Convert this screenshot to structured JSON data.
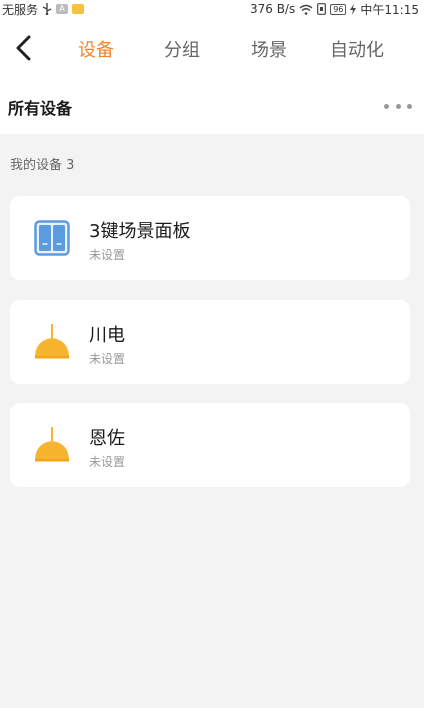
{
  "status_bar": {
    "carrier": "无服务",
    "speed": "376 B/s",
    "battery": "96",
    "time": "中午11:15"
  },
  "header": {
    "tabs": [
      {
        "label": "设备",
        "active": true
      },
      {
        "label": "分组",
        "active": false
      },
      {
        "label": "场景",
        "active": false
      },
      {
        "label": "自动化",
        "active": false
      }
    ]
  },
  "section": {
    "title": "所有设备"
  },
  "group": {
    "label": "我的设备 3"
  },
  "devices": [
    {
      "name": "3键场景面板",
      "status": "未设置",
      "icon": "scene-panel-icon"
    },
    {
      "name": "川电",
      "status": "未设置",
      "icon": "lamp-icon"
    },
    {
      "name": "恩佐",
      "status": "未设置",
      "icon": "lamp-icon"
    }
  ],
  "colors": {
    "accent": "#f0862d",
    "lamp": "#f7b52f",
    "panel": "#5b9be0",
    "background": "#f3f3f3"
  }
}
